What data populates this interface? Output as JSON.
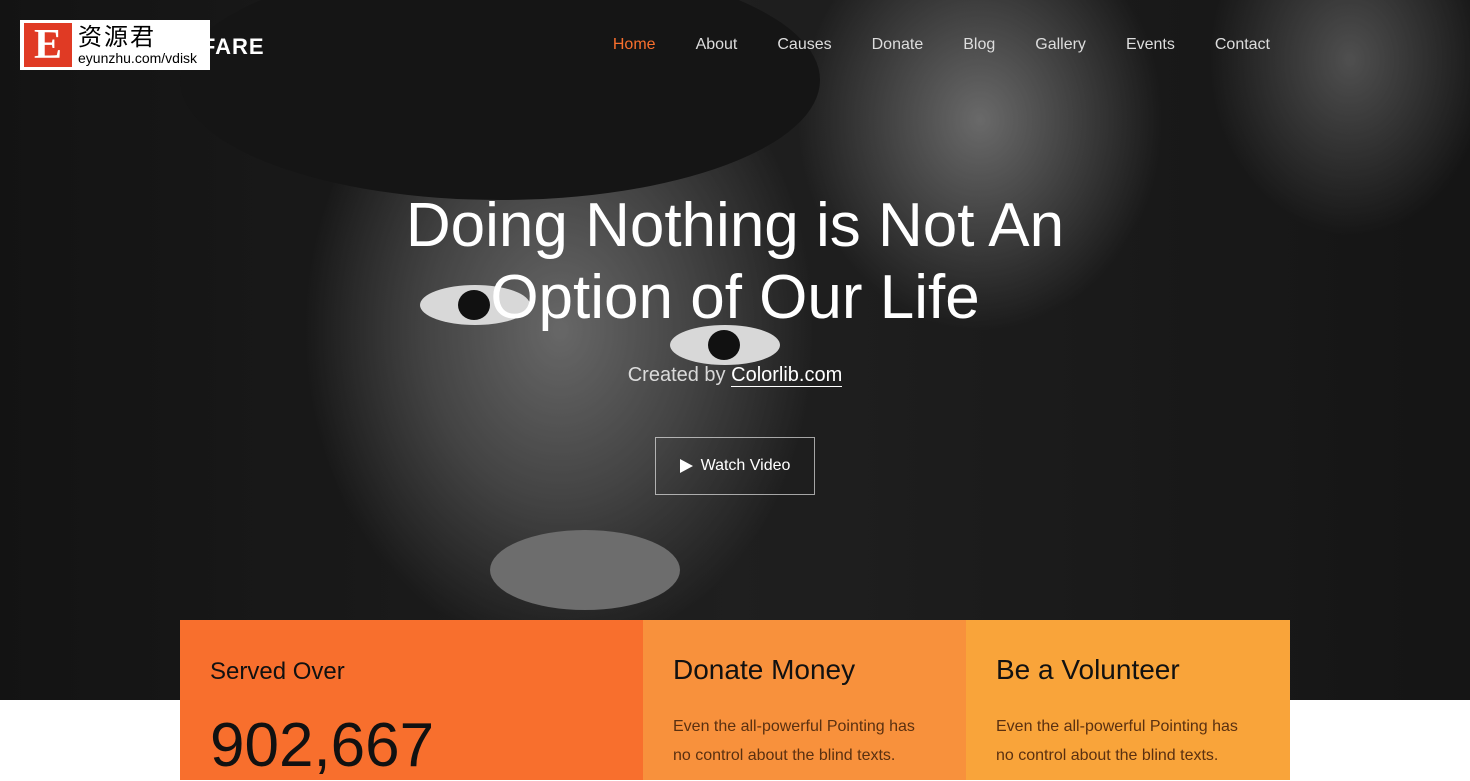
{
  "watermark": {
    "letter": "E",
    "chinese": "资源君",
    "url": "eyunzhu.com/vdisk"
  },
  "brand": "WELFARE",
  "nav": [
    {
      "label": "Home",
      "active": true
    },
    {
      "label": "About"
    },
    {
      "label": "Causes"
    },
    {
      "label": "Donate"
    },
    {
      "label": "Blog"
    },
    {
      "label": "Gallery"
    },
    {
      "label": "Events"
    },
    {
      "label": "Contact"
    }
  ],
  "hero": {
    "title_line1": "Doing Nothing is Not An",
    "title_line2": "Option of Our Life",
    "subtitle_prefix": "Created by",
    "subtitle_link": "Colorlib.com",
    "button_label": "Watch Video",
    "button_icon": "play-icon"
  },
  "cards": [
    {
      "title": "Served Over",
      "value": "902,667",
      "color": "#f86f2d"
    },
    {
      "title": "Donate Money",
      "text": "Even the all-powerful Pointing has no control about the blind texts.",
      "color": "#f8913c"
    },
    {
      "title": "Be a Volunteer",
      "text": "Even the all-powerful Pointing has no control about the blind texts.",
      "color": "#f9a43a"
    }
  ],
  "colors": {
    "accent": "#f86f2d"
  }
}
